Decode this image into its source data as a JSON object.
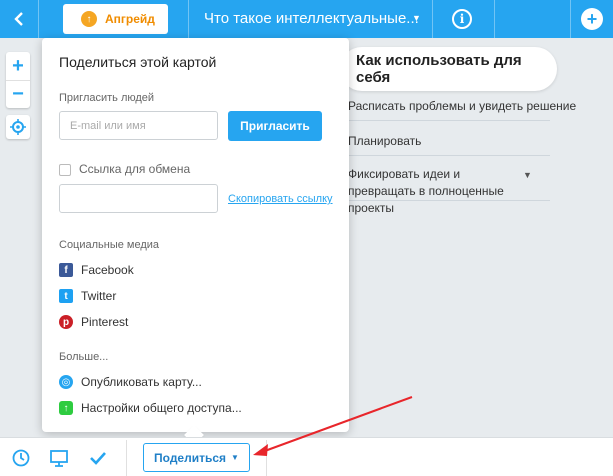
{
  "topbar": {
    "upgrade_label": "Апгрейд",
    "title": "Что такое интеллектуальные..."
  },
  "map": {
    "main_node": "Как использовать для себя",
    "branches": [
      "Расписать проблемы и увидеть решение",
      "Планировать",
      "Фиксировать идеи и превращать в полноценные проекты"
    ]
  },
  "popup": {
    "title": "Поделиться этой картой",
    "invite_section": "Пригласить людей",
    "email_placeholder": "E-mail или имя",
    "invite_button": "Пригласить",
    "share_link_label": "Ссылка для обмена",
    "copy_link": "Скопировать ссылку",
    "social_section": "Социальные медиа",
    "social": [
      {
        "label": "Facebook",
        "icon": "facebook-icon",
        "color": "#3b5998"
      },
      {
        "label": "Twitter",
        "icon": "twitter-icon",
        "color": "#1da1f2"
      },
      {
        "label": "Pinterest",
        "icon": "pinterest-icon",
        "color": "#cb2027"
      }
    ],
    "more_section": "Больше...",
    "more": [
      {
        "label": "Опубликовать карту...",
        "icon": "globe-icon",
        "color": "#26a5f0"
      },
      {
        "label": "Настройки общего доступа...",
        "icon": "share-settings-icon",
        "color": "#2ecc40"
      }
    ]
  },
  "bottombar": {
    "share_button": "Поделиться"
  },
  "colors": {
    "accent": "#26a5f0",
    "annotation_arrow": "#e8262b"
  }
}
